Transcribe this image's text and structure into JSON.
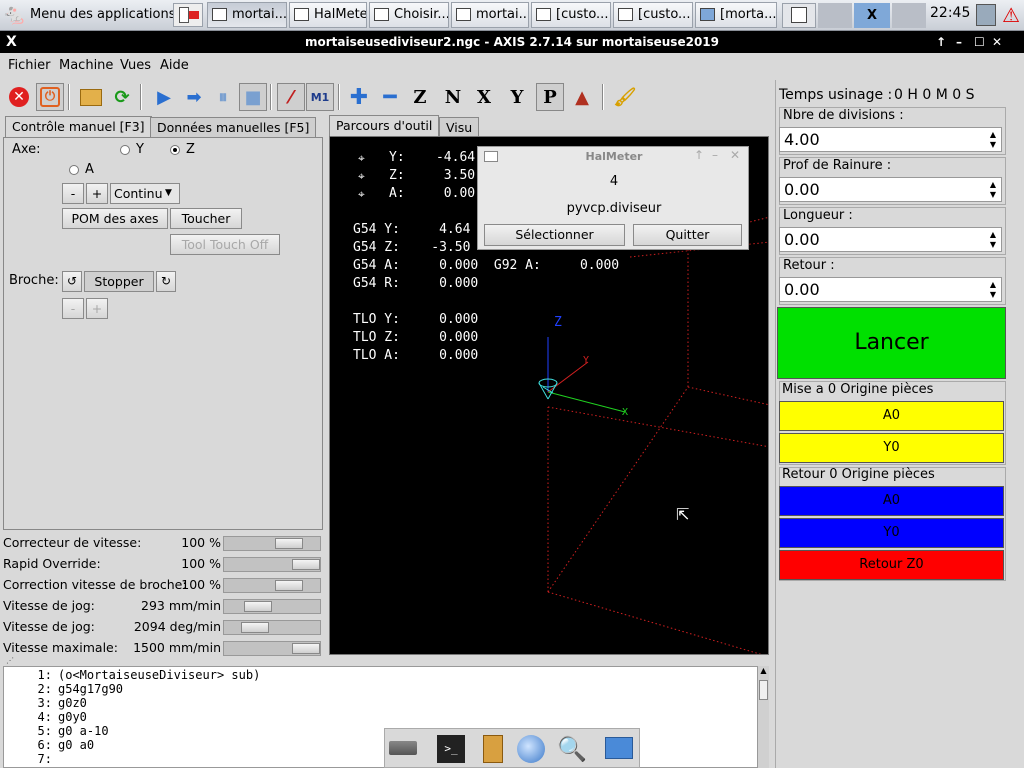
{
  "taskbar": {
    "apps_menu": "Menu des applications",
    "tasks": [
      "mortai...",
      "HalMeter",
      "Choisir...",
      "mortai...",
      "[custo...",
      "[custo...",
      "[morta..."
    ],
    "clock": "22:45"
  },
  "window": {
    "title": "mortaiseusediviseur2.ngc - AXIS 2.7.14 sur mortaiseuse2019"
  },
  "menu": [
    "Fichier",
    "Machine",
    "Vues",
    "Aide"
  ],
  "tabs_left": [
    "Contrôle manuel [F3]",
    "Données manuelles [F5]"
  ],
  "tabs_preview": [
    "Parcours d'outil",
    "Visu"
  ],
  "manual": {
    "axe_label": "Axe:",
    "axes": [
      "Y",
      "Z",
      "A"
    ],
    "selected_axis": "Z",
    "minus": "-",
    "plus": "+",
    "jog_mode": "Continu",
    "home_button": "POM des axes",
    "touch_button": "Toucher",
    "tool_touch_off": "Tool Touch Off",
    "spindle_label": "Broche:",
    "spindle_stop": "Stopper"
  },
  "sliders": [
    {
      "label": "Correcteur de vitesse:",
      "value": "100 %",
      "fraction": 0.75
    },
    {
      "label": "Rapid Override:",
      "value": "100 %",
      "fraction": 1.0
    },
    {
      "label": "Correction vitesse de broche:",
      "value": "100 %",
      "fraction": 0.75
    },
    {
      "label": "Vitesse de jog:",
      "value": "293 mm/min",
      "fraction": 0.3
    },
    {
      "label": "Vitesse de jog:",
      "value": "2094 deg/min",
      "fraction": 0.25
    },
    {
      "label": "Vitesse maximale:",
      "value": "1500 mm/min",
      "fraction": 1.0
    }
  ],
  "dro": {
    "pos_y": "Y:    -4.64",
    "pos_z": "Z:     3.50",
    "pos_a": "A:     0.00",
    "g54_y": "G54 Y:     4.64",
    "g54_z": "G54 Z:    -3.50",
    "g54_a": "G54 A:     0.000  G92 A:     0.000",
    "g54_r": "G54 R:     0.000",
    "tlo_y": "TLO Y:     0.000",
    "tlo_z": "TLO Z:     0.000",
    "tlo_a": "TLO A:     0.000",
    "axis_y": "Y",
    "axis_z": "Z",
    "axis_x": "X"
  },
  "halmeter": {
    "title": "HalMeter",
    "value": "4",
    "pin": "pyvcp.diviseur",
    "select": "Sélectionner",
    "quit": "Quitter"
  },
  "pyvcp": {
    "time_label": "Temps usinage :",
    "time_value": "0 H  0 M  0 S",
    "divisions_label": "Nbre de divisions :",
    "divisions_value": "4.00",
    "depth_label": "Prof de Rainure :",
    "depth_value": "0.00",
    "length_label": "Longueur :",
    "length_value": "0.00",
    "return_label": "Retour :",
    "return_value": "0.00",
    "launch": "Lancer",
    "zero_title": "Mise a 0 Origine pièces",
    "zero_a": "A0",
    "zero_y": "Y0",
    "return_title": "Retour 0 Origine pièces",
    "ret_a": "A0",
    "ret_y": "Y0",
    "ret_z": "Retour Z0"
  },
  "gcode": [
    {
      "n": "1:",
      "t": "(o<MortaiseuseDiviseur> sub)"
    },
    {
      "n": "2:",
      "t": "g54g17g90"
    },
    {
      "n": "3:",
      "t": "g0z0"
    },
    {
      "n": "4:",
      "t": "g0y0"
    },
    {
      "n": "5:",
      "t": "g0 a-10"
    },
    {
      "n": "6:",
      "t": "g0 a0"
    },
    {
      "n": "7:",
      "t": ""
    }
  ],
  "colors": {
    "launch": "#00e000",
    "yellow": "#ffff00",
    "blue": "#0000ff",
    "red": "#ff0000",
    "preview_bg": "#000000"
  }
}
